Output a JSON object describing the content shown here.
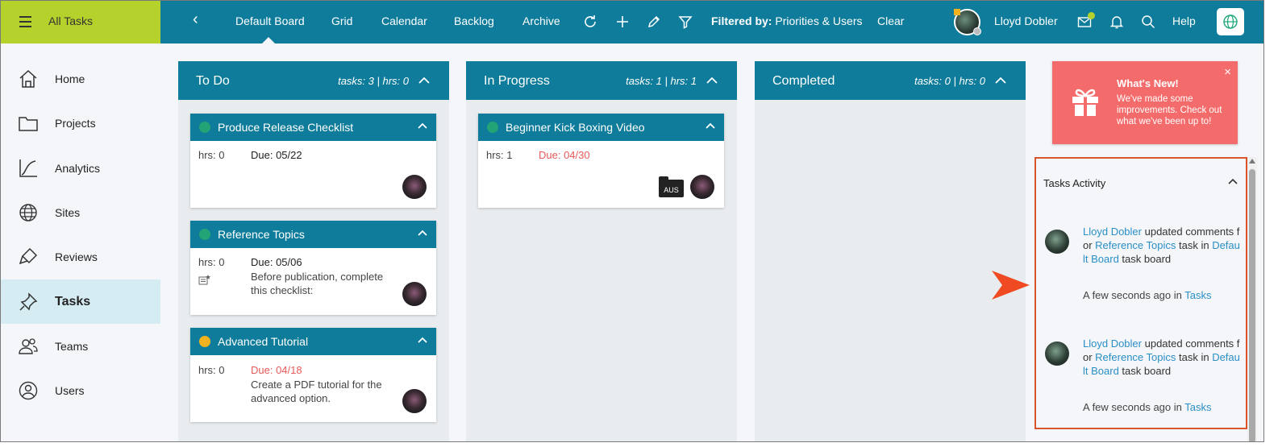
{
  "topbar": {
    "all_tasks": "All Tasks",
    "nav": [
      "Default Board",
      "Grid",
      "Calendar",
      "Backlog",
      "Archive"
    ],
    "filtered_label": "Filtered by:",
    "filtered_value": "Priorities & Users",
    "clear": "Clear",
    "user_name": "Lloyd Dobler",
    "help": "Help",
    "icons": [
      "back-icon",
      "refresh-icon",
      "plus-icon",
      "pencil-icon",
      "filter-icon",
      "mail-icon",
      "bell-icon",
      "search-icon",
      "globe-logo-icon"
    ]
  },
  "sidebar": {
    "items": [
      {
        "label": "Home",
        "icon": "home-icon"
      },
      {
        "label": "Projects",
        "icon": "folder-icon"
      },
      {
        "label": "Analytics",
        "icon": "chart-icon"
      },
      {
        "label": "Sites",
        "icon": "globe-icon"
      },
      {
        "label": "Reviews",
        "icon": "highlighter-icon"
      },
      {
        "label": "Tasks",
        "icon": "pin-icon"
      },
      {
        "label": "Teams",
        "icon": "people-icon"
      },
      {
        "label": "Users",
        "icon": "user-circle-icon"
      }
    ],
    "active": "Tasks"
  },
  "columns": [
    {
      "title": "To Do",
      "meta": "tasks: 3 | hrs: 0",
      "cards": [
        {
          "title": "Produce Release Checklist",
          "dot_color": "#22a477",
          "hrs": "hrs: 0",
          "due": "Due: 05/22",
          "overdue": false,
          "desc": ""
        },
        {
          "title": "Reference Topics",
          "dot_color": "#22a477",
          "hrs": "hrs: 0",
          "due": "Due: 05/06",
          "overdue": false,
          "desc": "Before publication, complete this checklist:"
        },
        {
          "title": "Advanced Tutorial",
          "dot_color": "#f2b21f",
          "hrs": "hrs: 0",
          "due": "Due: 04/18",
          "overdue": true,
          "desc": "Create a PDF tutorial for the advanced option."
        }
      ]
    },
    {
      "title": "In Progress",
      "meta": "tasks: 1 | hrs: 1",
      "cards": [
        {
          "title": "Beginner Kick Boxing Video",
          "dot_color": "#22a477",
          "hrs": "hrs: 1",
          "due": "Due: 04/30",
          "overdue": true,
          "desc": "",
          "badge": "AUS"
        }
      ]
    },
    {
      "title": "Completed",
      "meta": "tasks: 0 | hrs: 0",
      "cards": []
    }
  ],
  "whats_new": {
    "title": "What's New!",
    "body": "We've made some improvements. Check out what we've been up to!",
    "close": "×"
  },
  "activity": {
    "title": "Tasks Activity",
    "entries": [
      {
        "user": "Lloyd Dobler",
        "action": " updated comments for ",
        "target": "Reference Topics",
        "mid": " task in ",
        "board": "Default Board",
        "tail": " task board",
        "time": "A few seconds ago in ",
        "place": "Tasks"
      },
      {
        "user": "Lloyd Dobler",
        "action": " updated comments for ",
        "target": "Reference Topics",
        "mid": " task in ",
        "board": "Default Board",
        "tail": " task board",
        "time": "A few seconds ago in ",
        "place": "Tasks"
      }
    ]
  },
  "colors": {
    "header_teal": "#0e7c9a",
    "lime": "#b5d12b",
    "overdue_red": "#e85a5a",
    "whats_new_bg": "#f46b6b",
    "link_blue": "#2a8fc7",
    "highlight_border": "#d9532c"
  }
}
